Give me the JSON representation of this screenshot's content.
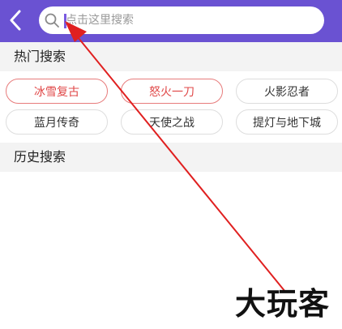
{
  "colors": {
    "top_bar": "#6a52d2",
    "hot_tag_border": "#e77b7b",
    "hot_tag_text": "#e04848",
    "section_bg": "#f3f3f3",
    "arrow": "#e02020"
  },
  "header": {
    "back_icon": "chevron-left-icon",
    "search": {
      "icon": "search-icon",
      "placeholder": "点击这里搜索"
    }
  },
  "hot_search": {
    "title": "热门搜索",
    "tags": [
      {
        "label": "冰雪复古",
        "highlighted": true
      },
      {
        "label": "怒火一刀",
        "highlighted": true
      },
      {
        "label": "火影忍者",
        "highlighted": false
      },
      {
        "label": "蓝月传奇",
        "highlighted": false
      },
      {
        "label": "天使之战",
        "highlighted": false
      },
      {
        "label": "提灯与地下城",
        "highlighted": false
      }
    ]
  },
  "history_search": {
    "title": "历史搜索"
  },
  "watermark": {
    "text": "大玩客"
  }
}
